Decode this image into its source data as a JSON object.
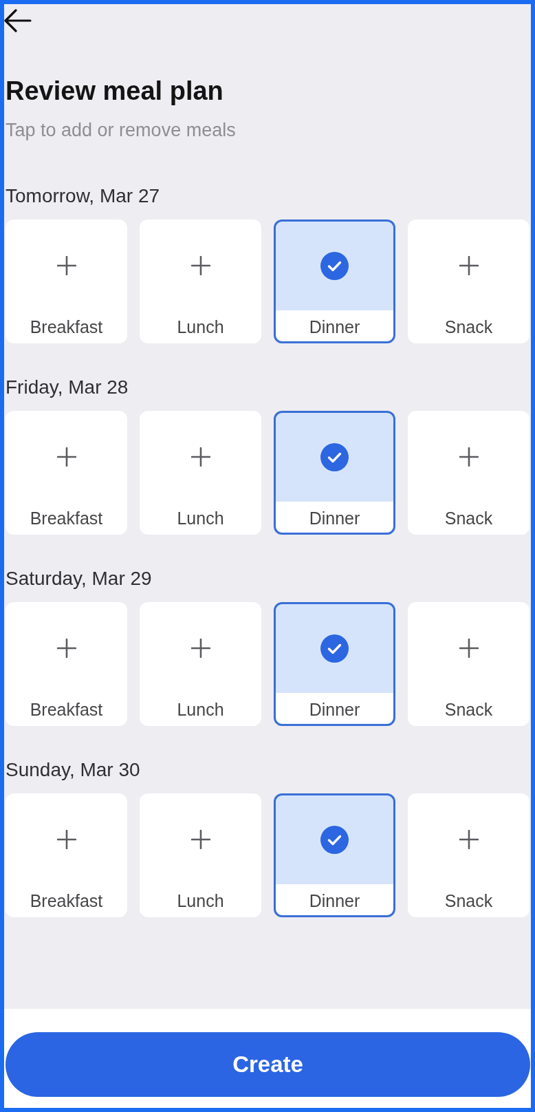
{
  "header": {
    "title": "Review meal plan",
    "subtitle": "Tap to add or remove meals"
  },
  "days": [
    {
      "label": "Tomorrow, Mar 27",
      "meals": [
        {
          "label": "Breakfast",
          "selected": false
        },
        {
          "label": "Lunch",
          "selected": false
        },
        {
          "label": "Dinner",
          "selected": true
        },
        {
          "label": "Snack",
          "selected": false
        }
      ]
    },
    {
      "label": "Friday, Mar 28",
      "meals": [
        {
          "label": "Breakfast",
          "selected": false
        },
        {
          "label": "Lunch",
          "selected": false
        },
        {
          "label": "Dinner",
          "selected": true
        },
        {
          "label": "Snack",
          "selected": false
        }
      ]
    },
    {
      "label": "Saturday, Mar 29",
      "meals": [
        {
          "label": "Breakfast",
          "selected": false
        },
        {
          "label": "Lunch",
          "selected": false
        },
        {
          "label": "Dinner",
          "selected": true
        },
        {
          "label": "Snack",
          "selected": false
        }
      ]
    },
    {
      "label": "Sunday, Mar 30",
      "meals": [
        {
          "label": "Breakfast",
          "selected": false
        },
        {
          "label": "Lunch",
          "selected": false
        },
        {
          "label": "Dinner",
          "selected": true
        },
        {
          "label": "Snack",
          "selected": false
        }
      ]
    }
  ],
  "create_button": {
    "label": "Create"
  }
}
